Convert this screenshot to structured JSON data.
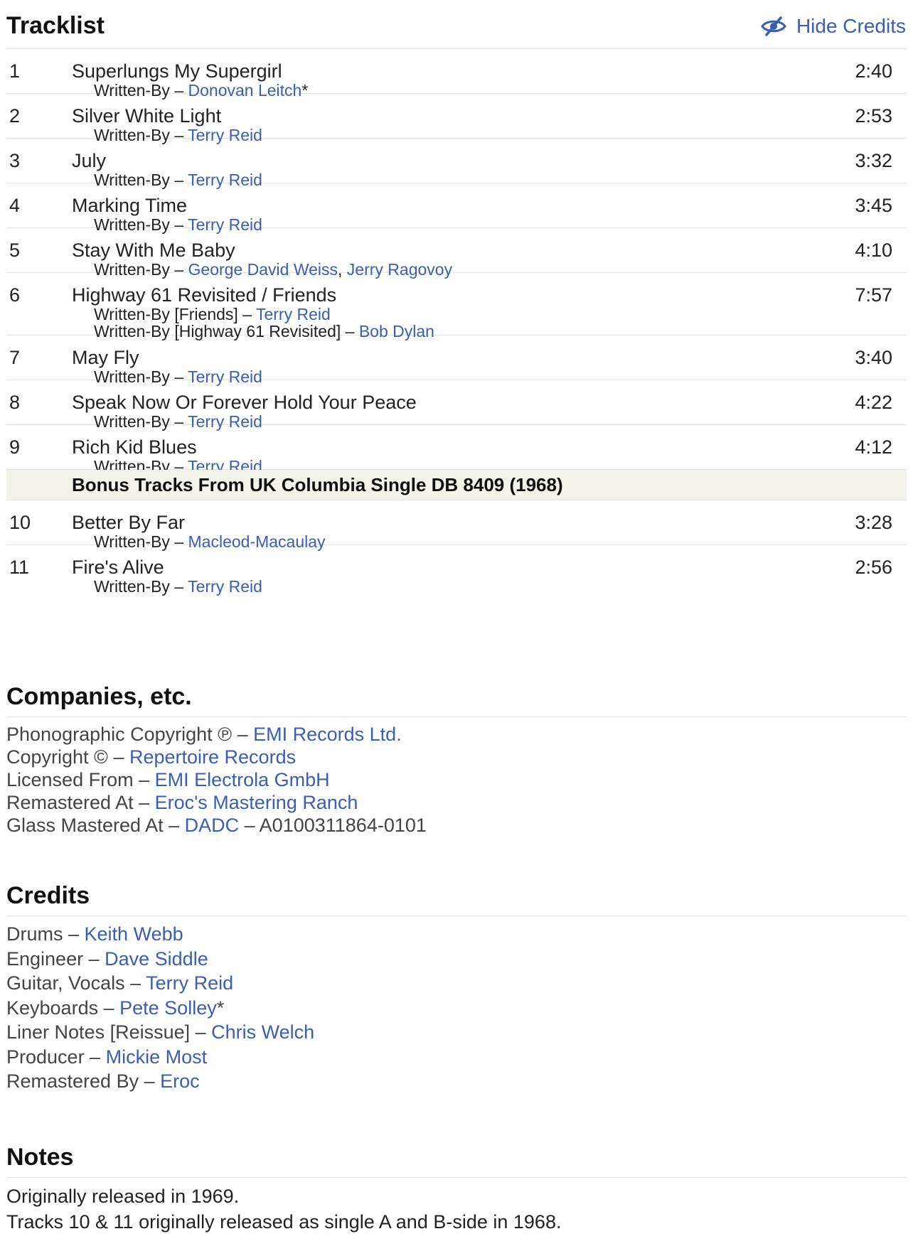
{
  "tracklist": {
    "title": "Tracklist",
    "hide_credits_label": "Hide Credits",
    "tracks": [
      {
        "num": "1",
        "title": "Superlungs My Supergirl",
        "duration": "2:40",
        "credits": [
          {
            "role": "Written-By",
            "sep": " – ",
            "names": [
              "Donovan Leitch"
            ],
            "suffix": "*"
          }
        ]
      },
      {
        "num": "2",
        "title": "Silver White Light",
        "duration": "2:53",
        "credits": [
          {
            "role": "Written-By",
            "sep": " – ",
            "names": [
              "Terry Reid"
            ],
            "suffix": ""
          }
        ]
      },
      {
        "num": "3",
        "title": "July",
        "duration": "3:32",
        "credits": [
          {
            "role": "Written-By",
            "sep": " – ",
            "names": [
              "Terry Reid"
            ],
            "suffix": ""
          }
        ]
      },
      {
        "num": "4",
        "title": "Marking Time",
        "duration": "3:45",
        "credits": [
          {
            "role": "Written-By",
            "sep": " – ",
            "names": [
              "Terry Reid"
            ],
            "suffix": ""
          }
        ]
      },
      {
        "num": "5",
        "title": "Stay With Me Baby",
        "duration": "4:10",
        "credits": [
          {
            "role": "Written-By",
            "sep": " – ",
            "names": [
              "George David Weiss",
              "Jerry Ragovoy"
            ],
            "suffix": ""
          }
        ]
      },
      {
        "num": "6",
        "title": "Highway 61 Revisited / Friends",
        "duration": "7:57",
        "credits": [
          {
            "role": "Written-By [Friends]",
            "sep": " – ",
            "names": [
              "Terry Reid"
            ],
            "suffix": ""
          },
          {
            "role": "Written-By [Highway 61 Revisited]",
            "sep": " – ",
            "names": [
              "Bob Dylan"
            ],
            "suffix": ""
          }
        ]
      },
      {
        "num": "7",
        "title": "May Fly",
        "duration": "3:40",
        "credits": [
          {
            "role": "Written-By",
            "sep": " – ",
            "names": [
              "Terry Reid"
            ],
            "suffix": ""
          }
        ]
      },
      {
        "num": "8",
        "title": "Speak Now Or Forever Hold Your Peace",
        "duration": "4:22",
        "credits": [
          {
            "role": "Written-By",
            "sep": " – ",
            "names": [
              "Terry Reid"
            ],
            "suffix": ""
          }
        ]
      },
      {
        "num": "9",
        "title": "Rich Kid Blues",
        "duration": "4:12",
        "credits": [
          {
            "role": "Written-By",
            "sep": " – ",
            "names": [
              "Terry Reid"
            ],
            "suffix": ""
          }
        ]
      },
      {
        "heading": "Bonus Tracks From UK Columbia Single DB 8409 (1968)"
      },
      {
        "num": "10",
        "title": "Better By Far",
        "duration": "3:28",
        "credits": [
          {
            "role": "Written-By",
            "sep": " – ",
            "names": [
              "Macleod-Macaulay"
            ],
            "suffix": ""
          }
        ]
      },
      {
        "num": "11",
        "title": "Fire's Alive",
        "duration": "2:56",
        "credits": [
          {
            "role": "Written-By",
            "sep": " – ",
            "names": [
              "Terry Reid"
            ],
            "suffix": ""
          }
        ]
      }
    ]
  },
  "companies": {
    "title": "Companies, etc.",
    "items": [
      {
        "role": "Phonographic Copyright ℗",
        "sep": " – ",
        "names": [
          "EMI Records Ltd."
        ],
        "suffix": ""
      },
      {
        "role": "Copyright ©",
        "sep": " – ",
        "names": [
          "Repertoire Records"
        ],
        "suffix": ""
      },
      {
        "role": "Licensed From",
        "sep": " – ",
        "names": [
          "EMI Electrola GmbH"
        ],
        "suffix": ""
      },
      {
        "role": "Remastered At",
        "sep": " – ",
        "names": [
          "Eroc's Mastering Ranch"
        ],
        "suffix": ""
      },
      {
        "role": "Glass Mastered At",
        "sep": " – ",
        "names": [
          "DADC"
        ],
        "suffix": " – A0100311864-0101"
      }
    ]
  },
  "credits": {
    "title": "Credits",
    "items": [
      {
        "role": "Drums",
        "sep": " – ",
        "names": [
          "Keith Webb"
        ],
        "suffix": ""
      },
      {
        "role": "Engineer",
        "sep": " – ",
        "names": [
          "Dave Siddle"
        ],
        "suffix": ""
      },
      {
        "role": "Guitar, Vocals",
        "sep": " – ",
        "names": [
          "Terry Reid"
        ],
        "suffix": ""
      },
      {
        "role": "Keyboards",
        "sep": " – ",
        "names": [
          "Pete Solley"
        ],
        "suffix": "*"
      },
      {
        "role": "Liner Notes [Reissue]",
        "sep": " – ",
        "names": [
          "Chris Welch"
        ],
        "suffix": ""
      },
      {
        "role": "Producer",
        "sep": " – ",
        "names": [
          "Mickie Most"
        ],
        "suffix": ""
      },
      {
        "role": "Remastered By",
        "sep": " – ",
        "names": [
          "Eroc"
        ],
        "suffix": ""
      }
    ]
  },
  "notes": {
    "title": "Notes",
    "lines": [
      "Originally released in 1969.",
      "Tracks 10 & 11 originally released as single A and B-side in 1968."
    ]
  },
  "colors": {
    "link": "#3a5eb3",
    "heading_bg": "#f3f3e9",
    "rule": "#e3e3e3"
  }
}
